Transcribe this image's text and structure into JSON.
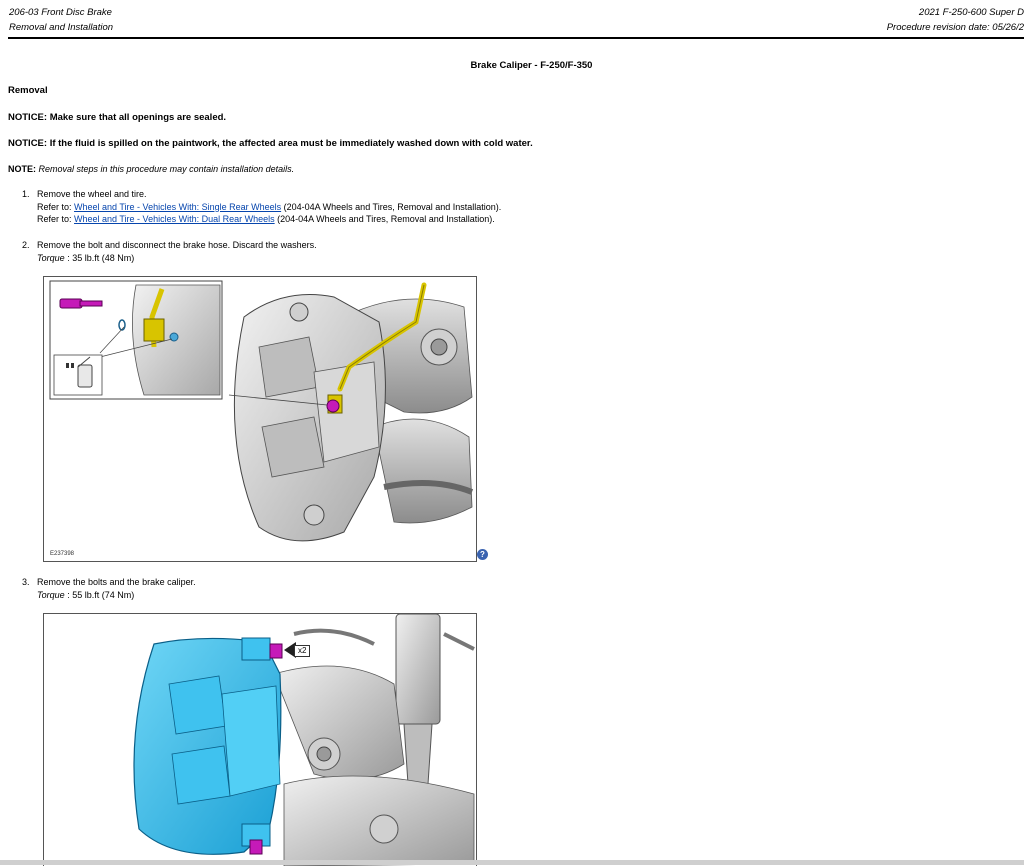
{
  "header": {
    "section": "206-03 Front Disc Brake",
    "subsection": "Removal and Installation",
    "vehicle": "2021 F-250-600 Super D",
    "revision": "Procedure revision date: 05/26/2"
  },
  "title": "Brake Caliper - F-250/F-350",
  "removal_heading": "Removal",
  "notices": [
    {
      "label": "NOTICE:",
      "text": "Make sure that all openings are sealed."
    },
    {
      "label": "NOTICE:",
      "text": "If the fluid is spilled on the paintwork, the affected area must be immediately washed down with cold water."
    }
  ],
  "note": {
    "label": "NOTE:",
    "text": "Removal steps in this procedure may contain installation details."
  },
  "steps": [
    {
      "num": "1.",
      "text": "Remove the wheel and tire.",
      "refs": [
        {
          "prefix": "Refer to:",
          "link": "Wheel and Tire - Vehicles With: Single Rear Wheels",
          "suffix": "(204-04A Wheels and Tires, Removal and Installation)."
        },
        {
          "prefix": "Refer to:",
          "link": "Wheel and Tire - Vehicles With: Dual Rear Wheels",
          "suffix": "(204-04A Wheels and Tires, Removal and Installation)."
        }
      ]
    },
    {
      "num": "2.",
      "text": "Remove the bolt and disconnect the brake hose. Discard the washers.",
      "torque_label": "Torque",
      "torque_value": ": 35 lb.ft (48 Nm)"
    },
    {
      "num": "3.",
      "text": "Remove the bolts and the brake caliper.",
      "torque_label": "Torque",
      "torque_value": ": 55 lb.ft (74 Nm)"
    }
  ],
  "figures": [
    {
      "code": "E237398",
      "help": "?"
    },
    {
      "callout": "x2"
    }
  ],
  "colors": {
    "caliper_highlight": "#29b6e8",
    "hose_highlight": "#d8c400",
    "bolt_highlight": "#c51ab8",
    "link": "#0645ad"
  }
}
